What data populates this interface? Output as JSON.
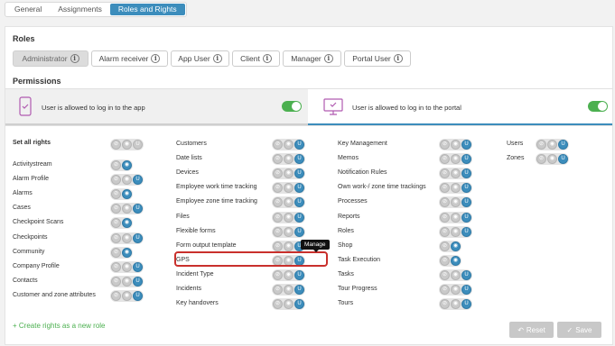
{
  "tabs": [
    "General",
    "Assignments",
    "Roles and Rights"
  ],
  "roles_title": "Roles",
  "roles": [
    "Administrator",
    "Alarm receiver",
    "App User",
    "Client",
    "Manager",
    "Portal User"
  ],
  "info_glyph": "i",
  "permissions_title": "Permissions",
  "perm_app_text": "User is allowed to log in to the app",
  "perm_portal_text": "User is allowed to log in to the portal",
  "set_all_label": "Set all rights",
  "tooltip": "Manage",
  "create_link": "+ Create rights as a new role",
  "reset_label": "Reset",
  "save_label": "Save",
  "accent_color": "#3c8dbc",
  "toggle_color": "#4cb050",
  "highlight_color": "#c9302c",
  "columns": [
    {
      "rows": [
        {
          "label": "Activitystream",
          "type": 2,
          "state": "view"
        },
        {
          "label": "Alarm Profile",
          "type": 3,
          "state": "manage"
        },
        {
          "label": "Alarms",
          "type": 2,
          "state": "view"
        },
        {
          "label": "Cases",
          "type": 3,
          "state": "manage"
        },
        {
          "label": "Checkpoint Scans",
          "type": 2,
          "state": "view"
        },
        {
          "label": "Checkpoints",
          "type": 3,
          "state": "manage"
        },
        {
          "label": "Community",
          "type": 2,
          "state": "view"
        },
        {
          "label": "Company Profile",
          "type": 3,
          "state": "manage"
        },
        {
          "label": "Contacts",
          "type": 3,
          "state": "manage"
        },
        {
          "label": "Customer and zone attributes",
          "type": 3,
          "state": "manage"
        }
      ]
    },
    {
      "rows": [
        {
          "label": "Customers",
          "type": 3,
          "state": "manage"
        },
        {
          "label": "Date lists",
          "type": 3,
          "state": "manage"
        },
        {
          "label": "Devices",
          "type": 3,
          "state": "manage"
        },
        {
          "label": "Employee work time tracking",
          "type": 3,
          "state": "manage"
        },
        {
          "label": "Employee zone time tracking",
          "type": 3,
          "state": "manage"
        },
        {
          "label": "Files",
          "type": 3,
          "state": "manage"
        },
        {
          "label": "Flexible forms",
          "type": 3,
          "state": "manage"
        },
        {
          "label": "Form output template",
          "type": 3,
          "state": "manage"
        },
        {
          "label": "GPS",
          "type": 3,
          "state": "manage"
        },
        {
          "label": "Incident Type",
          "type": 3,
          "state": "manage"
        },
        {
          "label": "Incidents",
          "type": 3,
          "state": "manage"
        },
        {
          "label": "Key handovers",
          "type": 3,
          "state": "manage"
        }
      ]
    },
    {
      "rows": [
        {
          "label": "Key Management",
          "type": 3,
          "state": "manage"
        },
        {
          "label": "Memos",
          "type": 3,
          "state": "manage"
        },
        {
          "label": "Notification Rules",
          "type": 3,
          "state": "manage"
        },
        {
          "label": "Own work-/ zone time trackings",
          "type": 3,
          "state": "manage"
        },
        {
          "label": "Processes",
          "type": 3,
          "state": "manage"
        },
        {
          "label": "Reports",
          "type": 3,
          "state": "manage"
        },
        {
          "label": "Roles",
          "type": 3,
          "state": "manage"
        },
        {
          "label": "Shop",
          "type": 2,
          "state": "view"
        },
        {
          "label": "Task Execution",
          "type": 2,
          "state": "view"
        },
        {
          "label": "Tasks",
          "type": 3,
          "state": "manage"
        },
        {
          "label": "Tour Progress",
          "type": 3,
          "state": "manage"
        },
        {
          "label": "Tours",
          "type": 3,
          "state": "manage"
        }
      ]
    },
    {
      "rows": [
        {
          "label": "Users",
          "type": 3,
          "state": "manage"
        },
        {
          "label": "Zones",
          "type": 3,
          "state": "manage"
        }
      ]
    }
  ]
}
